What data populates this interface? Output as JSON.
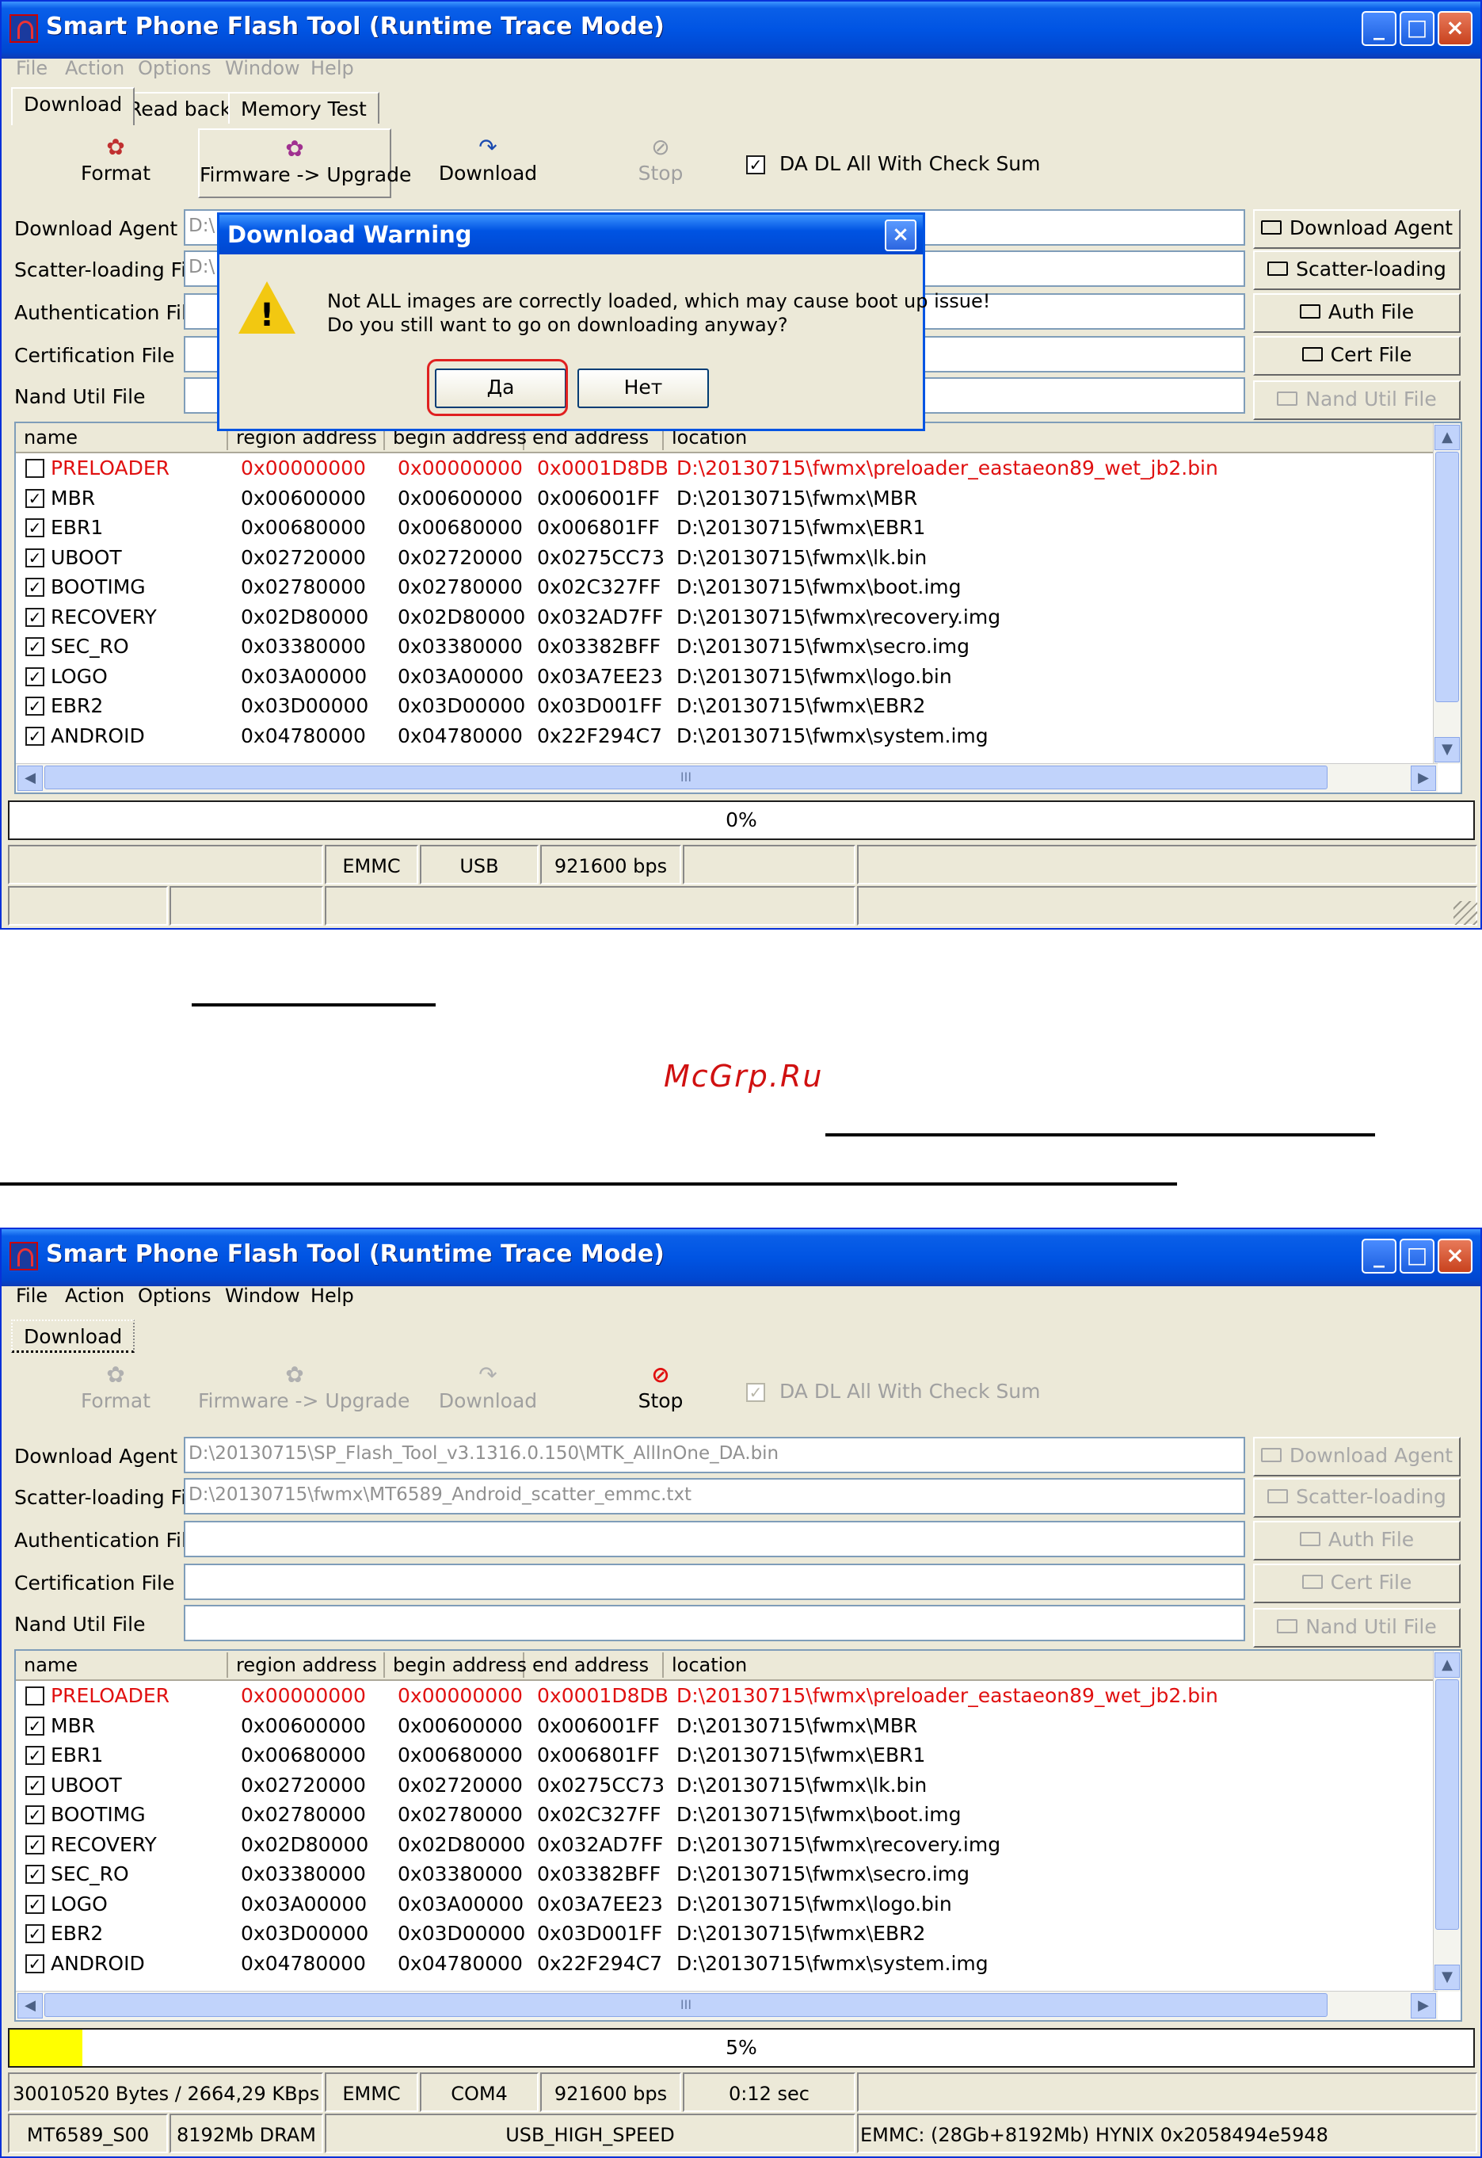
{
  "window": {
    "title": "Smart Phone Flash Tool (Runtime Trace Mode)",
    "controls": [
      "_",
      "□",
      "×"
    ]
  },
  "menu": [
    "File",
    "Action",
    "Options",
    "Window",
    "Help"
  ],
  "screen1": {
    "tabs": [
      "Download",
      "Read back",
      "Memory Test"
    ],
    "toolbar": {
      "format": "Format",
      "firmware": "Firmware -> Upgrade",
      "download": "Download",
      "stop": "Stop",
      "checksum": "DA DL All With Check Sum"
    },
    "files": {
      "labels": [
        "Download Agent",
        "Scatter-loading File",
        "Authentication File",
        "Certification File",
        "Nand Util File"
      ],
      "values": [
        "D:\\",
        "D:\\",
        "",
        "",
        ""
      ]
    },
    "side_buttons": [
      "Download Agent",
      "Scatter-loading",
      "Auth File",
      "Cert File",
      "Nand Util File"
    ],
    "progress": {
      "value": 0,
      "text": "0%"
    },
    "status1": [
      "",
      "EMMC",
      "USB",
      "921600 bps",
      "",
      ""
    ],
    "status2": [
      "",
      "",
      "",
      ""
    ],
    "dialog": {
      "title": "Download Warning",
      "close": "×",
      "message_line1": "Not ALL images are correctly loaded, which may cause boot up issue!",
      "message_line2": "Do you still want to go on downloading anyway?",
      "yes": "Да",
      "no": "Нет"
    }
  },
  "screen2": {
    "tabs": [
      "Download"
    ],
    "toolbar": {
      "format": "Format",
      "firmware": "Firmware -> Upgrade",
      "download": "Download",
      "stop": "Stop",
      "checksum": "DA DL All With Check Sum"
    },
    "files": {
      "labels": [
        "Download Agent",
        "Scatter-loading File",
        "Authentication File",
        "Certification File",
        "Nand Util File"
      ],
      "values": [
        "D:\\20130715\\SP_Flash_Tool_v3.1316.0.150\\MTK_AllInOne_DA.bin",
        "D:\\20130715\\fwmx\\MT6589_Android_scatter_emmc.txt",
        "",
        "",
        ""
      ]
    },
    "side_buttons": [
      "Download Agent",
      "Scatter-loading",
      "Auth File",
      "Cert File",
      "Nand Util File"
    ],
    "progress": {
      "value": 0.05,
      "text": "5%"
    },
    "status1": [
      "30010520 Bytes / 2664,29 KBps",
      "EMMC",
      "COM4",
      "921600 bps",
      "0:12 sec",
      ""
    ],
    "status2": [
      "MT6589_S00",
      "8192Mb DRAM",
      "USB_HIGH_SPEED",
      "EMMC: (28Gb+8192Mb) HYNIX 0x2058494e5948"
    ]
  },
  "table": {
    "columns": [
      "name",
      "region address",
      "begin address",
      "end address",
      "location"
    ],
    "rows": [
      {
        "checked": false,
        "highlight": true,
        "name": "PRELOADER",
        "region": "0x00000000",
        "begin": "0x00000000",
        "end": "0x0001D8DB",
        "location": "D:\\20130715\\fwmx\\preloader_eastaeon89_wet_jb2.bin"
      },
      {
        "checked": true,
        "highlight": false,
        "name": "MBR",
        "region": "0x00600000",
        "begin": "0x00600000",
        "end": "0x006001FF",
        "location": "D:\\20130715\\fwmx\\MBR"
      },
      {
        "checked": true,
        "highlight": false,
        "name": "EBR1",
        "region": "0x00680000",
        "begin": "0x00680000",
        "end": "0x006801FF",
        "location": "D:\\20130715\\fwmx\\EBR1"
      },
      {
        "checked": true,
        "highlight": false,
        "name": "UBOOT",
        "region": "0x02720000",
        "begin": "0x02720000",
        "end": "0x0275CC73",
        "location": "D:\\20130715\\fwmx\\lk.bin"
      },
      {
        "checked": true,
        "highlight": false,
        "name": "BOOTIMG",
        "region": "0x02780000",
        "begin": "0x02780000",
        "end": "0x02C327FF",
        "location": "D:\\20130715\\fwmx\\boot.img"
      },
      {
        "checked": true,
        "highlight": false,
        "name": "RECOVERY",
        "region": "0x02D80000",
        "begin": "0x02D80000",
        "end": "0x032AD7FF",
        "location": "D:\\20130715\\fwmx\\recovery.img"
      },
      {
        "checked": true,
        "highlight": false,
        "name": "SEC_RO",
        "region": "0x03380000",
        "begin": "0x03380000",
        "end": "0x03382BFF",
        "location": "D:\\20130715\\fwmx\\secro.img"
      },
      {
        "checked": true,
        "highlight": false,
        "name": "LOGO",
        "region": "0x03A00000",
        "begin": "0x03A00000",
        "end": "0x03A7EE23",
        "location": "D:\\20130715\\fwmx\\logo.bin"
      },
      {
        "checked": true,
        "highlight": false,
        "name": "EBR2",
        "region": "0x03D00000",
        "begin": "0x03D00000",
        "end": "0x03D001FF",
        "location": "D:\\20130715\\fwmx\\EBR2"
      },
      {
        "checked": true,
        "highlight": false,
        "name": "ANDROID",
        "region": "0x04780000",
        "begin": "0x04780000",
        "end": "0x22F294C7",
        "location": "D:\\20130715\\fwmx\\system.img"
      }
    ],
    "scroll_grip": "III"
  },
  "watermark": "McGrp.Ru",
  "colors": {
    "titlebar": "#0054e3",
    "window_bg": "#ece9d8",
    "highlight_row": "#e01010",
    "progress_fill": "#ffff00",
    "dialog_highlight": "#e02020"
  }
}
